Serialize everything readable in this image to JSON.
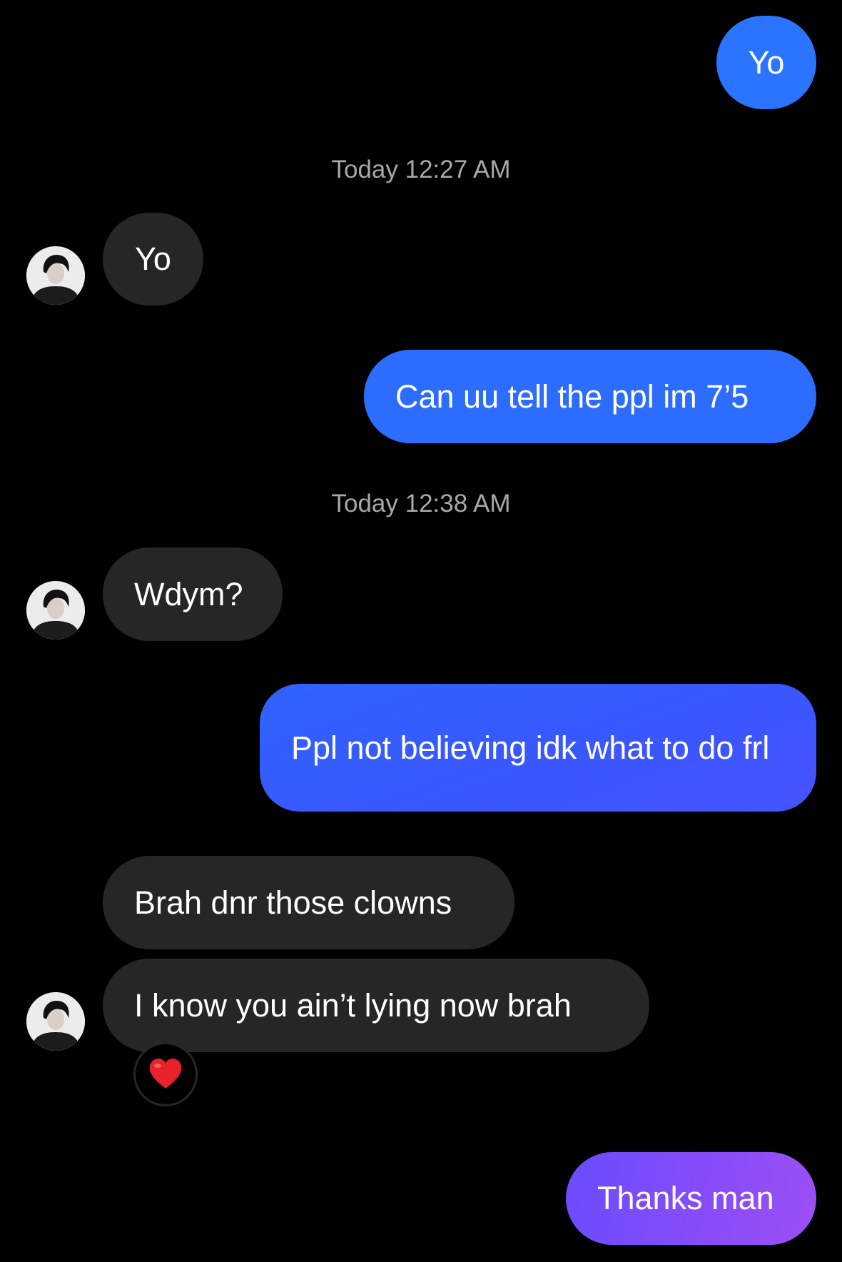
{
  "colors": {
    "background": "#000000",
    "incoming_bubble": "#262626",
    "outgoing_top": "#2a72ff",
    "outgoing_mid": "#3a55ff",
    "outgoing_bottom": "#8d4df5",
    "timestamp": "#a8a8a8"
  },
  "thread": {
    "messages": [
      {
        "direction": "outgoing",
        "text": "Yo"
      },
      {
        "type": "timestamp",
        "text": "Today 12:27 AM"
      },
      {
        "direction": "incoming",
        "text": "Yo",
        "avatar": "contact-avatar"
      },
      {
        "direction": "outgoing",
        "text": "Can uu tell the ppl im 7’5"
      },
      {
        "type": "timestamp",
        "text": "Today 12:38 AM"
      },
      {
        "direction": "incoming",
        "text": "Wdym?",
        "avatar": "contact-avatar"
      },
      {
        "direction": "outgoing",
        "text": "Ppl not believing idk what to do frl"
      },
      {
        "direction": "incoming",
        "text": "Brah dnr those clowns"
      },
      {
        "direction": "incoming",
        "text": "I know you ain’t lying now brah",
        "avatar": "contact-avatar",
        "reaction": "heart-icon"
      },
      {
        "direction": "outgoing",
        "text": "Thanks man"
      }
    ]
  }
}
